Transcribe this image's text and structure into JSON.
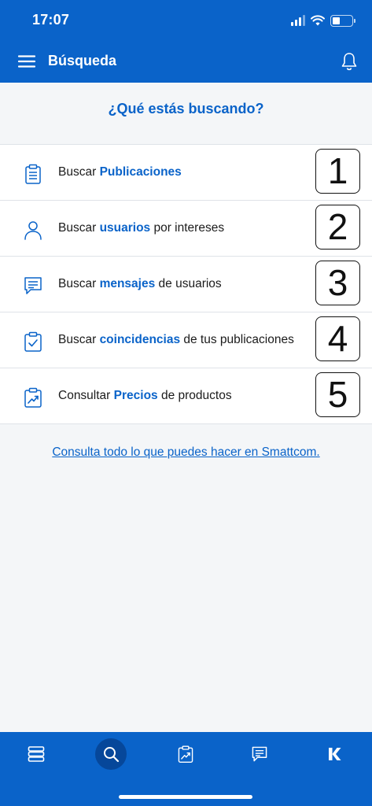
{
  "status_bar": {
    "time": "17:07"
  },
  "header": {
    "title": "Búsqueda"
  },
  "main": {
    "question": "¿Qué estás buscando?",
    "options": [
      {
        "prefix": "Buscar ",
        "highlight": "Publicaciones",
        "suffix": "",
        "number": "1",
        "icon": "clipboard-list-icon"
      },
      {
        "prefix": "Buscar ",
        "highlight": "usuarios",
        "suffix": " por intereses",
        "number": "2",
        "icon": "user-icon"
      },
      {
        "prefix": "Buscar ",
        "highlight": "mensajes",
        "suffix": " de usuarios",
        "number": "3",
        "icon": "message-icon"
      },
      {
        "prefix": "Buscar ",
        "highlight": "coincidencias",
        "suffix": " de tus publicaciones",
        "number": "4",
        "icon": "clipboard-check-icon"
      },
      {
        "prefix": "Consultar ",
        "highlight": "Precios",
        "suffix": " de productos",
        "number": "5",
        "icon": "clipboard-chart-icon"
      }
    ],
    "more_link": "Consulta todo lo que puedes hacer en Smattcom."
  },
  "tabbar": {
    "tabs": [
      {
        "icon": "stack-icon",
        "active": false
      },
      {
        "icon": "search-icon",
        "active": true
      },
      {
        "icon": "clipboard-chart-icon",
        "active": false
      },
      {
        "icon": "message-icon",
        "active": false
      },
      {
        "icon": "k-logo-icon",
        "active": false
      }
    ]
  },
  "colors": {
    "brand_blue": "#0a63c9",
    "active_tab": "#06479a",
    "background": "#f4f6f8"
  }
}
